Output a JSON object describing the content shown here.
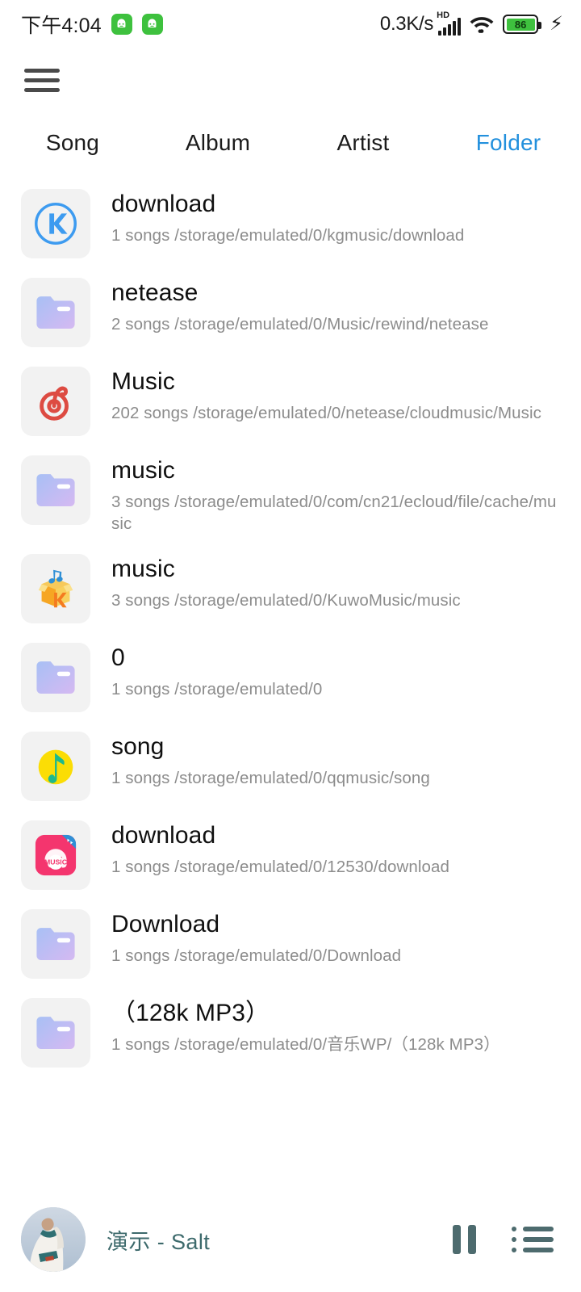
{
  "status_bar": {
    "time": "下午4:04",
    "notification_icons": [
      "app-badge-icon",
      "app-badge-icon"
    ],
    "network_speed": "0.3K/s",
    "hd_label": "HD",
    "signal_icon": "cellular-signal-icon",
    "wifi_icon": "wifi-icon",
    "battery_level": "86",
    "charging_icon": "charging-bolt-icon",
    "battery_color": "#3ec13e"
  },
  "appbar": {
    "menu_icon": "hamburger-menu-icon"
  },
  "tabs": {
    "active_color": "#2290dd",
    "items": [
      {
        "label": "Song",
        "active": false
      },
      {
        "label": "Album",
        "active": false
      },
      {
        "label": "Artist",
        "active": false
      },
      {
        "label": "Folder",
        "active": true
      }
    ]
  },
  "folders": [
    {
      "name": "download",
      "subtitle": "1 songs /storage/emulated/0/kgmusic/download",
      "icon": "kugou-music-icon"
    },
    {
      "name": "netease",
      "subtitle": "2 songs /storage/emulated/0/Music/rewind/netease",
      "icon": "folder-icon"
    },
    {
      "name": "Music",
      "subtitle": "202 songs /storage/emulated/0/netease/cloudmusic/Music",
      "icon": "netease-cloudmusic-icon"
    },
    {
      "name": "music",
      "subtitle": "3 songs /storage/emulated/0/com/cn21/ecloud/file/cache/music",
      "icon": "folder-icon"
    },
    {
      "name": "music",
      "subtitle": "3 songs /storage/emulated/0/KuwoMusic/music",
      "icon": "kuwo-music-icon"
    },
    {
      "name": "0",
      "subtitle": "1 songs /storage/emulated/0",
      "icon": "folder-icon"
    },
    {
      "name": "song",
      "subtitle": "1 songs /storage/emulated/0/qqmusic/song",
      "icon": "qq-music-icon"
    },
    {
      "name": "download",
      "subtitle": "1 songs /storage/emulated/0/12530/download",
      "icon": "migu-music-icon"
    },
    {
      "name": "Download",
      "subtitle": "1 songs /storage/emulated/0/Download",
      "icon": "folder-icon"
    },
    {
      "name": "（128k MP3）",
      "subtitle": "1 songs /storage/emulated/0/音乐WP/（128k MP3）",
      "icon": "folder-icon"
    }
  ],
  "player": {
    "album_art": "album-art-thumbnail",
    "now_playing": "演示 - Salt",
    "pause_icon": "pause-icon",
    "queue_icon": "playlist-queue-icon",
    "accent_color": "#3d6a6c"
  }
}
